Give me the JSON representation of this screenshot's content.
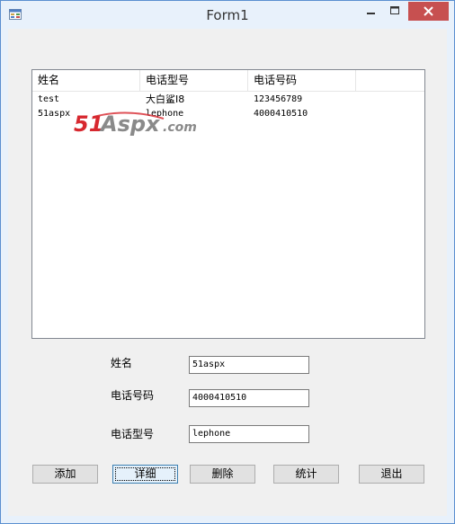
{
  "window": {
    "title": "Form1"
  },
  "titlebar": {
    "minimize_glyph": "—",
    "maximize_glyph": "☐",
    "close_glyph": "✕"
  },
  "listview": {
    "columns": [
      "姓名",
      "电话型号",
      "电话号码"
    ],
    "rows": [
      [
        "test",
        "大白鲨I8",
        "123456789"
      ],
      [
        "51aspx",
        "lephone",
        "4000410510"
      ]
    ]
  },
  "watermark": {
    "text_51": "51",
    "text_aspx": "Aspx",
    "text_com": ".com",
    "color_red": "#d7282f",
    "color_gray": "#8a8a8a"
  },
  "form": {
    "name_label": "姓名",
    "name_value": "51aspx",
    "phone_number_label": "电话号码",
    "phone_number_value": "4000410510",
    "phone_model_label": "电话型号",
    "phone_model_value": "lephone"
  },
  "buttons": {
    "add": "添加",
    "detail": "详细",
    "delete": "删除",
    "stats": "统计",
    "exit": "退出"
  }
}
